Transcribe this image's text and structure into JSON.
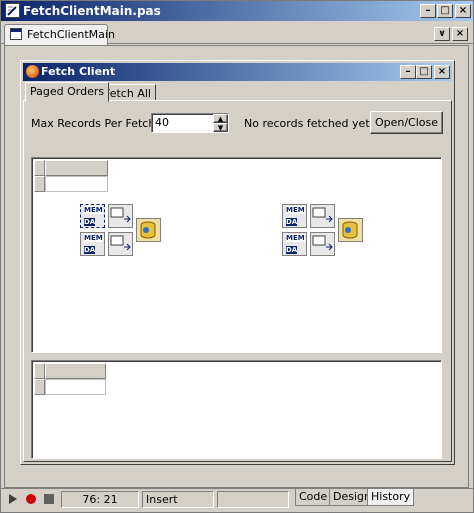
{
  "window": {
    "title": "FetchClientMain.pas"
  },
  "editor_tab": {
    "label": "FetchClientMain"
  },
  "form": {
    "title": "Fetch Client",
    "tabs": [
      {
        "label": "Paged Orders"
      },
      {
        "label": "Fetch All"
      }
    ],
    "max_records_label": "Max Records Per Fetch:",
    "max_records_value": "40",
    "status_text": "No records fetched yet...",
    "open_close_label": "Open/Close",
    "component_labels": {
      "mem": "MEM",
      "da": "DA"
    }
  },
  "statusbar": {
    "position": "76:  21",
    "mode": "Insert",
    "tabs": [
      {
        "label": "Code"
      },
      {
        "label": "Design"
      },
      {
        "label": "History"
      }
    ]
  },
  "colors": {
    "titlebar": "#0a246a",
    "face": "#d4d0c8",
    "record": "#cc0000"
  }
}
